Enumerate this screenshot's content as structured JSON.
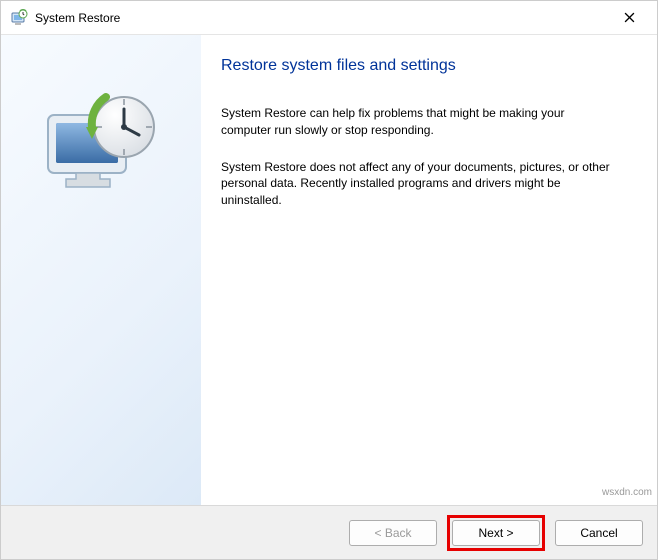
{
  "titlebar": {
    "title": "System Restore",
    "icon": "system-restore-icon",
    "close_icon": "close-icon"
  },
  "main": {
    "heading": "Restore system files and settings",
    "para1": "System Restore can help fix problems that might be making your computer run slowly or stop responding.",
    "para2": "System Restore does not affect any of your documents, pictures, or other personal data. Recently installed programs and drivers might be uninstalled."
  },
  "footer": {
    "back_label": "< Back",
    "next_label": "Next >",
    "cancel_label": "Cancel"
  },
  "watermark": "wsxdn.com"
}
